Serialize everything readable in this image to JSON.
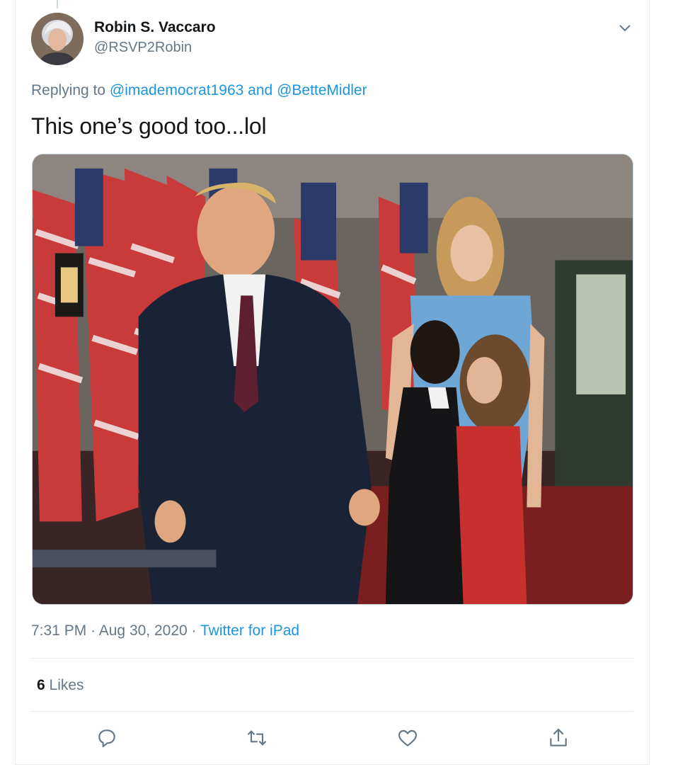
{
  "tweet": {
    "author_name": "Robin S. Vaccaro",
    "author_handle": "@RSVP2Robin",
    "replying_prefix": "Replying to",
    "reply_to_1": "@imademocrat1963",
    "reply_and": "and",
    "reply_to_2": "@BetteMidler",
    "text": "This one’s good too...lol",
    "time": "7:31 PM",
    "date": "Aug 30, 2020",
    "source": "Twitter for iPad",
    "like_count": "6",
    "like_label": "Likes"
  },
  "icons": {
    "menu": "chevron-down-icon",
    "reply": "reply-icon",
    "retweet": "retweet-icon",
    "like": "heart-icon",
    "share": "share-icon"
  },
  "colors": {
    "link": "#1b95e0",
    "secondary_text": "#657786",
    "primary_text": "#14171a",
    "divider": "#e6ecf0"
  }
}
